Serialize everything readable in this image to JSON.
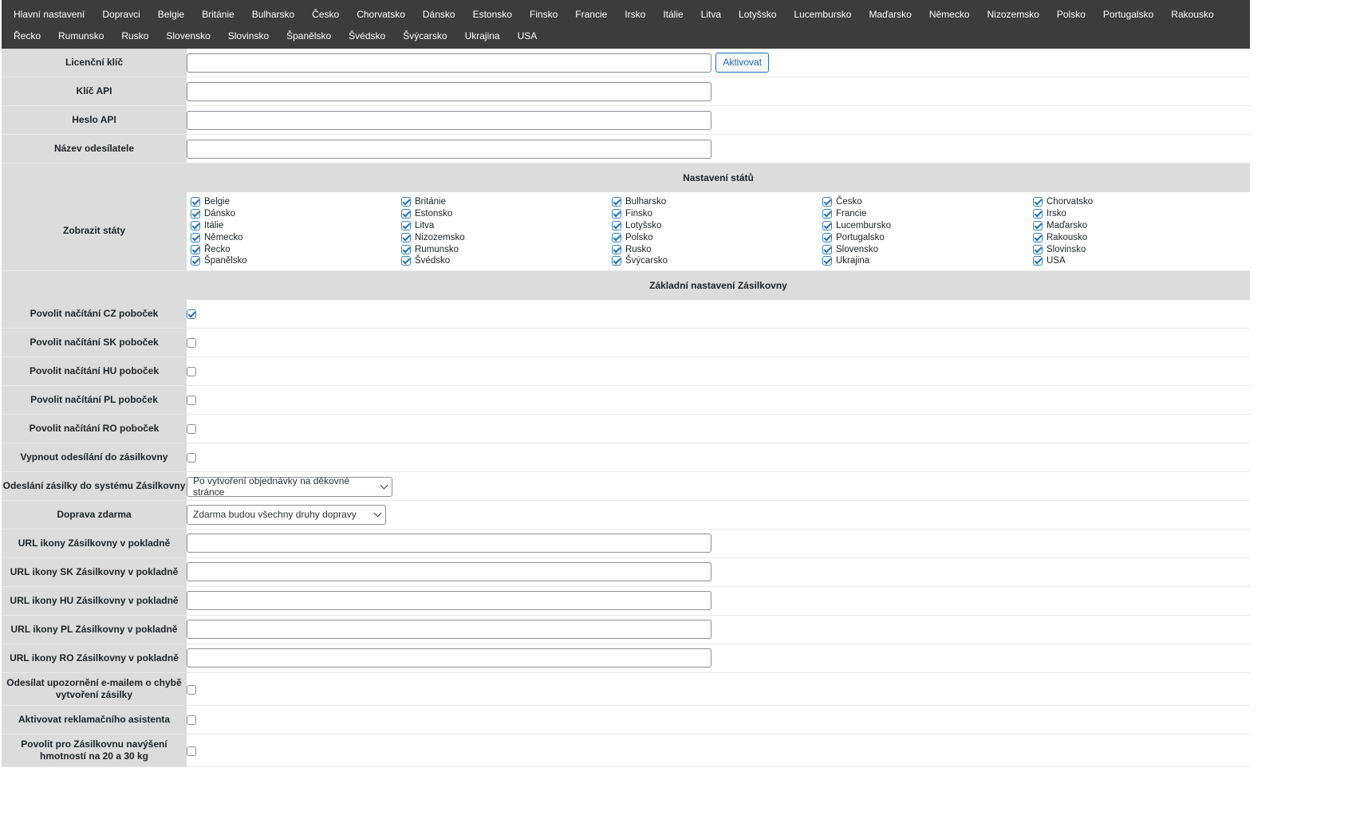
{
  "tabs": [
    "Hlavní nastavení",
    "Dopravci",
    "Belgie",
    "Británie",
    "Bulharsko",
    "Česko",
    "Chorvatsko",
    "Dánsko",
    "Estonsko",
    "Finsko",
    "Francie",
    "Irsko",
    "Itálie",
    "Litva",
    "Lotyšsko",
    "Lucembursko",
    "Maďarsko",
    "Německo",
    "Nizozemsko",
    "Polsko",
    "Portugalsko",
    "Rakousko",
    "Řecko",
    "Rumunsko",
    "Rusko",
    "Slovensko",
    "Slovinsko",
    "Španělsko",
    "Švédsko",
    "Švýcarsko",
    "Ukrajina",
    "USA"
  ],
  "fields": {
    "license_key": {
      "label": "Licenční klíč",
      "value": "",
      "button": "Aktivovat"
    },
    "api_key": {
      "label": "Klíč API",
      "value": ""
    },
    "api_password": {
      "label": "Heslo API",
      "value": ""
    },
    "sender_name": {
      "label": "Název odesílatele",
      "value": ""
    }
  },
  "states_section": {
    "title": "Nastavení států",
    "label": "Zobrazit státy",
    "states": [
      {
        "name": "Belgie",
        "checked": true
      },
      {
        "name": "Británie",
        "checked": true
      },
      {
        "name": "Bulharsko",
        "checked": true
      },
      {
        "name": "Česko",
        "checked": true
      },
      {
        "name": "Chorvatsko",
        "checked": true
      },
      {
        "name": "Dánsko",
        "checked": true
      },
      {
        "name": "Estonsko",
        "checked": true
      },
      {
        "name": "Finsko",
        "checked": true
      },
      {
        "name": "Francie",
        "checked": true
      },
      {
        "name": "Irsko",
        "checked": true
      },
      {
        "name": "Itálie",
        "checked": true
      },
      {
        "name": "Litva",
        "checked": true
      },
      {
        "name": "Lotyšsko",
        "checked": true
      },
      {
        "name": "Lucembursko",
        "checked": true
      },
      {
        "name": "Maďarsko",
        "checked": true
      },
      {
        "name": "Německo",
        "checked": true
      },
      {
        "name": "Nizozemsko",
        "checked": true
      },
      {
        "name": "Polsko",
        "checked": true
      },
      {
        "name": "Portugalsko",
        "checked": true
      },
      {
        "name": "Rakousko",
        "checked": true
      },
      {
        "name": "Řecko",
        "checked": true
      },
      {
        "name": "Rumunsko",
        "checked": true
      },
      {
        "name": "Rusko",
        "checked": true
      },
      {
        "name": "Slovensko",
        "checked": true
      },
      {
        "name": "Slovinsko",
        "checked": true
      },
      {
        "name": "Španělsko",
        "checked": true
      },
      {
        "name": "Švédsko",
        "checked": true
      },
      {
        "name": "Švýcarsko",
        "checked": true
      },
      {
        "name": "Ukrajina",
        "checked": true
      },
      {
        "name": "USA",
        "checked": true
      }
    ]
  },
  "basic_section": {
    "title": "Základní nastavení Zásilkovny",
    "checkboxes_top": [
      {
        "label": "Povolit načítání CZ poboček",
        "checked": true
      },
      {
        "label": "Povolit načítání SK poboček",
        "checked": false
      },
      {
        "label": "Povolit načítání HU poboček",
        "checked": false
      },
      {
        "label": "Povolit načítání PL poboček",
        "checked": false
      },
      {
        "label": "Povolit načítání RO poboček",
        "checked": false
      },
      {
        "label": "Vypnout odesílání do zásilkovny",
        "checked": false
      }
    ],
    "send_select": {
      "label": "Odeslání zásilky do systému Zásilkovny",
      "value": "Po vytvoření objednávky na děkovné stránce"
    },
    "free_select": {
      "label": "Doprava zdarma",
      "value": "Zdarma budou všechny druhy dopravy"
    },
    "icon_urls": [
      {
        "label": "URL ikony Zásilkovny v pokladně",
        "value": ""
      },
      {
        "label": "URL ikony SK Zásilkovny v pokladně",
        "value": ""
      },
      {
        "label": "URL ikony HU Zásilkovny v pokladně",
        "value": ""
      },
      {
        "label": "URL ikony PL Zásilkovny v pokladně",
        "value": ""
      },
      {
        "label": "URL ikony RO Zásilkovny v pokladně",
        "value": ""
      }
    ],
    "checkboxes_bottom": [
      {
        "label": "Odesílat upozornění e-mailem o chybě vytvoření zásilky",
        "checked": false
      },
      {
        "label": "Aktivovat reklamačního asistenta",
        "checked": false
      },
      {
        "label": "Povolit pro Zásilkovnu navýšení hmotností na 20 a 30 kg",
        "checked": false
      }
    ]
  }
}
